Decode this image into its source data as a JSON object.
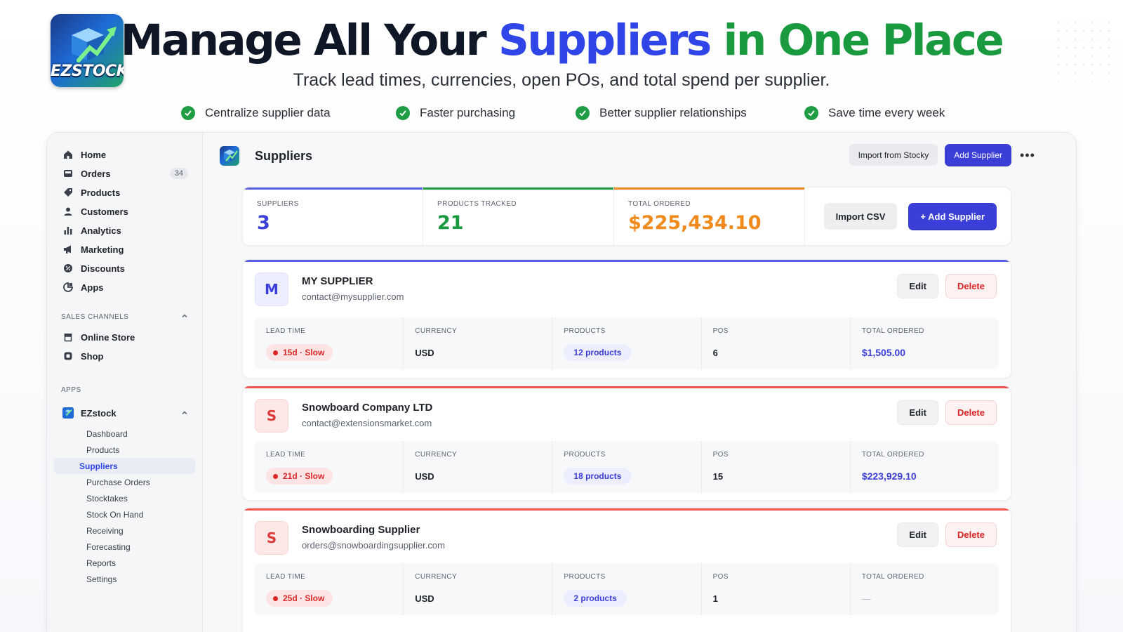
{
  "hero": {
    "title_part1": "Manage All Your ",
    "title_part2": "Suppliers",
    "title_part3": " in One Place",
    "subtitle": "Track lead times, currencies, open POs, and total spend per supplier.",
    "logo_text": "EZSTOCK",
    "benefits": [
      "Centralize supplier data",
      "Faster purchasing",
      "Better supplier relationships",
      "Save time every week"
    ]
  },
  "sidebar": {
    "items": [
      {
        "label": "Home",
        "icon": "home-icon"
      },
      {
        "label": "Orders",
        "icon": "inbox-icon",
        "badge": "34"
      },
      {
        "label": "Products",
        "icon": "tag-icon"
      },
      {
        "label": "Customers",
        "icon": "person-icon"
      },
      {
        "label": "Analytics",
        "icon": "bar-chart-icon"
      },
      {
        "label": "Marketing",
        "icon": "megaphone-icon"
      },
      {
        "label": "Discounts",
        "icon": "discount-icon"
      },
      {
        "label": "Apps",
        "icon": "apps-icon"
      }
    ],
    "sales_channels_label": "SALES CHANNELS",
    "sales_channels": [
      {
        "label": "Online Store",
        "icon": "store-icon"
      },
      {
        "label": "Shop",
        "icon": "shop-icon"
      }
    ],
    "apps_label": "APPS",
    "app_name": "EZstock",
    "app_items": [
      "Dashboard",
      "Products",
      "Suppliers",
      "Purchase Orders",
      "Stocktakes",
      "Stock On Hand",
      "Receiving",
      "Forecasting",
      "Reports",
      "Settings"
    ],
    "active_app_item": "Suppliers"
  },
  "topbar": {
    "title": "Suppliers",
    "import_label": "Import from Stocky",
    "add_label": "Add Supplier",
    "more_label": "•••"
  },
  "stats": {
    "suppliers_label": "SUPPLIERS",
    "suppliers_value": "3",
    "products_label": "PRODUCTS TRACKED",
    "products_value": "21",
    "total_label": "TOTAL ORDERED",
    "total_value": "$225,434.10",
    "import_csv_label": "Import CSV",
    "add_supplier_label": "+ Add Supplier"
  },
  "colors": {
    "accent": "#3b3fd8",
    "green": "#1a9a3e",
    "orange": "#f08a1c",
    "red": "#dc2626"
  },
  "labels": {
    "lead_time": "LEAD TIME",
    "currency": "CURRENCY",
    "products": "PRODUCTS",
    "pos": "POS",
    "total_ordered": "TOTAL ORDERED",
    "edit": "Edit",
    "delete": "Delete"
  },
  "suppliers": [
    {
      "initial": "M",
      "name": "MY SUPPLIER",
      "email": "contact@mysupplier.com",
      "lead_time": "15d · Slow",
      "currency": "USD",
      "products": "12 products",
      "pos": "6",
      "total_ordered": "$1,505.00"
    },
    {
      "initial": "S",
      "name": "Snowboard Company LTD",
      "email": "contact@extensionsmarket.com",
      "lead_time": "21d · Slow",
      "currency": "USD",
      "products": "18 products",
      "pos": "15",
      "total_ordered": "$223,929.10"
    },
    {
      "initial": "S",
      "name": "Snowboarding Supplier",
      "email": "orders@snowboardingsupplier.com",
      "lead_time": "25d · Slow",
      "currency": "USD",
      "products": "2 products",
      "pos": "1",
      "total_ordered": "—"
    }
  ]
}
